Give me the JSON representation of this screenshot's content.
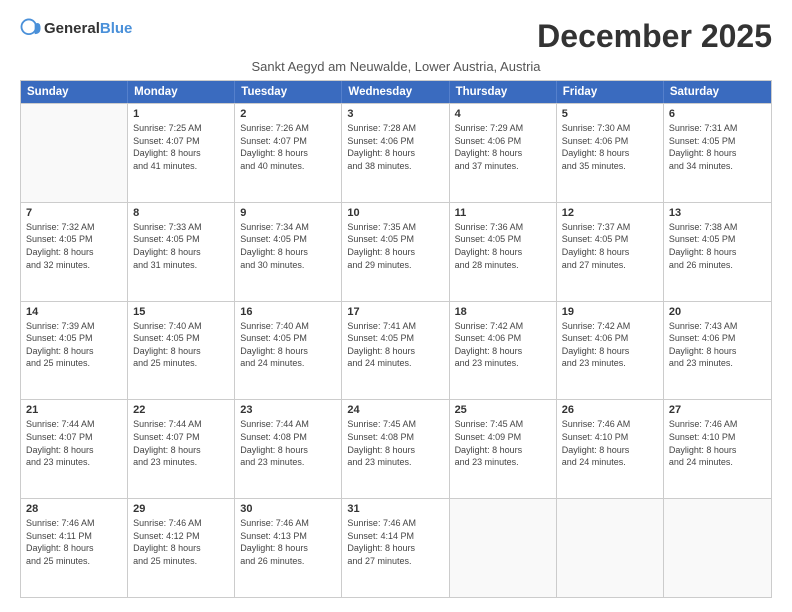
{
  "header": {
    "logo_general": "General",
    "logo_blue": "Blue",
    "month_title": "December 2025",
    "subtitle": "Sankt Aegyd am Neuwalde, Lower Austria, Austria"
  },
  "weekdays": [
    "Sunday",
    "Monday",
    "Tuesday",
    "Wednesday",
    "Thursday",
    "Friday",
    "Saturday"
  ],
  "weeks": [
    [
      {
        "day": "",
        "info": ""
      },
      {
        "day": "1",
        "info": "Sunrise: 7:25 AM\nSunset: 4:07 PM\nDaylight: 8 hours\nand 41 minutes."
      },
      {
        "day": "2",
        "info": "Sunrise: 7:26 AM\nSunset: 4:07 PM\nDaylight: 8 hours\nand 40 minutes."
      },
      {
        "day": "3",
        "info": "Sunrise: 7:28 AM\nSunset: 4:06 PM\nDaylight: 8 hours\nand 38 minutes."
      },
      {
        "day": "4",
        "info": "Sunrise: 7:29 AM\nSunset: 4:06 PM\nDaylight: 8 hours\nand 37 minutes."
      },
      {
        "day": "5",
        "info": "Sunrise: 7:30 AM\nSunset: 4:06 PM\nDaylight: 8 hours\nand 35 minutes."
      },
      {
        "day": "6",
        "info": "Sunrise: 7:31 AM\nSunset: 4:05 PM\nDaylight: 8 hours\nand 34 minutes."
      }
    ],
    [
      {
        "day": "7",
        "info": "Sunrise: 7:32 AM\nSunset: 4:05 PM\nDaylight: 8 hours\nand 32 minutes."
      },
      {
        "day": "8",
        "info": "Sunrise: 7:33 AM\nSunset: 4:05 PM\nDaylight: 8 hours\nand 31 minutes."
      },
      {
        "day": "9",
        "info": "Sunrise: 7:34 AM\nSunset: 4:05 PM\nDaylight: 8 hours\nand 30 minutes."
      },
      {
        "day": "10",
        "info": "Sunrise: 7:35 AM\nSunset: 4:05 PM\nDaylight: 8 hours\nand 29 minutes."
      },
      {
        "day": "11",
        "info": "Sunrise: 7:36 AM\nSunset: 4:05 PM\nDaylight: 8 hours\nand 28 minutes."
      },
      {
        "day": "12",
        "info": "Sunrise: 7:37 AM\nSunset: 4:05 PM\nDaylight: 8 hours\nand 27 minutes."
      },
      {
        "day": "13",
        "info": "Sunrise: 7:38 AM\nSunset: 4:05 PM\nDaylight: 8 hours\nand 26 minutes."
      }
    ],
    [
      {
        "day": "14",
        "info": "Sunrise: 7:39 AM\nSunset: 4:05 PM\nDaylight: 8 hours\nand 25 minutes."
      },
      {
        "day": "15",
        "info": "Sunrise: 7:40 AM\nSunset: 4:05 PM\nDaylight: 8 hours\nand 25 minutes."
      },
      {
        "day": "16",
        "info": "Sunrise: 7:40 AM\nSunset: 4:05 PM\nDaylight: 8 hours\nand 24 minutes."
      },
      {
        "day": "17",
        "info": "Sunrise: 7:41 AM\nSunset: 4:05 PM\nDaylight: 8 hours\nand 24 minutes."
      },
      {
        "day": "18",
        "info": "Sunrise: 7:42 AM\nSunset: 4:06 PM\nDaylight: 8 hours\nand 23 minutes."
      },
      {
        "day": "19",
        "info": "Sunrise: 7:42 AM\nSunset: 4:06 PM\nDaylight: 8 hours\nand 23 minutes."
      },
      {
        "day": "20",
        "info": "Sunrise: 7:43 AM\nSunset: 4:06 PM\nDaylight: 8 hours\nand 23 minutes."
      }
    ],
    [
      {
        "day": "21",
        "info": "Sunrise: 7:44 AM\nSunset: 4:07 PM\nDaylight: 8 hours\nand 23 minutes."
      },
      {
        "day": "22",
        "info": "Sunrise: 7:44 AM\nSunset: 4:07 PM\nDaylight: 8 hours\nand 23 minutes."
      },
      {
        "day": "23",
        "info": "Sunrise: 7:44 AM\nSunset: 4:08 PM\nDaylight: 8 hours\nand 23 minutes."
      },
      {
        "day": "24",
        "info": "Sunrise: 7:45 AM\nSunset: 4:08 PM\nDaylight: 8 hours\nand 23 minutes."
      },
      {
        "day": "25",
        "info": "Sunrise: 7:45 AM\nSunset: 4:09 PM\nDaylight: 8 hours\nand 23 minutes."
      },
      {
        "day": "26",
        "info": "Sunrise: 7:46 AM\nSunset: 4:10 PM\nDaylight: 8 hours\nand 24 minutes."
      },
      {
        "day": "27",
        "info": "Sunrise: 7:46 AM\nSunset: 4:10 PM\nDaylight: 8 hours\nand 24 minutes."
      }
    ],
    [
      {
        "day": "28",
        "info": "Sunrise: 7:46 AM\nSunset: 4:11 PM\nDaylight: 8 hours\nand 25 minutes."
      },
      {
        "day": "29",
        "info": "Sunrise: 7:46 AM\nSunset: 4:12 PM\nDaylight: 8 hours\nand 25 minutes."
      },
      {
        "day": "30",
        "info": "Sunrise: 7:46 AM\nSunset: 4:13 PM\nDaylight: 8 hours\nand 26 minutes."
      },
      {
        "day": "31",
        "info": "Sunrise: 7:46 AM\nSunset: 4:14 PM\nDaylight: 8 hours\nand 27 minutes."
      },
      {
        "day": "",
        "info": ""
      },
      {
        "day": "",
        "info": ""
      },
      {
        "day": "",
        "info": ""
      }
    ]
  ]
}
